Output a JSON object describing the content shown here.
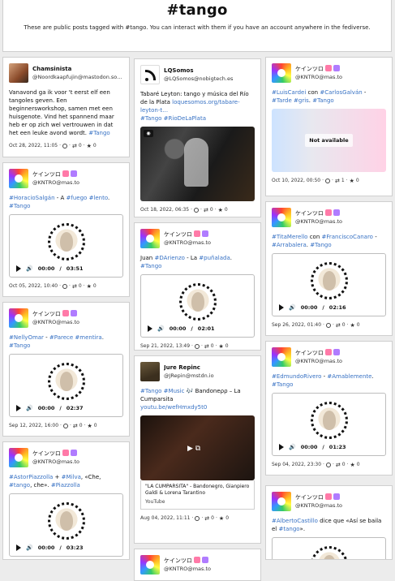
{
  "header": {
    "title": "#tango",
    "subtitle": "These are public posts tagged with #tango. You can interact with them if you have an account anywhere in the fediverse."
  },
  "cards": {
    "c1": {
      "name": "Chamsinista",
      "handle": "@Noordkaapfujin@mastodon.soc…",
      "text": "Vanavond ga ik voor 't eerst elf een tangoles geven. Een beginnersworkshop, samen met een huisgenote. Vind het spannend maar heb er op zich wel vertrouwen in dat het een leuke avond wordt. ",
      "tag1": "#Tango",
      "date": "Oct 28, 2022, 11:05",
      "boosts": "0",
      "favs": "0"
    },
    "c2": {
      "name": "ケインツロ",
      "handle": "@KNTRO@mas.to",
      "t1": "#HoracioSalgán",
      "t2": " - A ",
      "t3": "#fuego",
      "t4": " ",
      "t5": "#lento",
      "t6": ".",
      "t7": "#Tango",
      "time": "00:00",
      "sep": "/",
      "duration": "03:51",
      "date": "Oct 05, 2022, 10:40",
      "boosts": "0",
      "favs": "0"
    },
    "c3": {
      "name": "ケインツロ",
      "handle": "@KNTRO@mas.to",
      "t1": "#NellyOmar",
      "t2": " - ",
      "t3": "#Parece",
      "t4": " ",
      "t5": "#mentira",
      "t6": ". ",
      "t7": "#Tango",
      "time": "00:00",
      "sep": "/",
      "duration": "02:37",
      "date": "Sep 12, 2022, 16:00",
      "boosts": "0",
      "favs": "0"
    },
    "c4": {
      "name": "ケインツロ",
      "handle": "@KNTRO@mas.to",
      "t1": "#AstorPiazzolla",
      "t2": " + ",
      "t3": "#Milva",
      "t4": ", «Che, ",
      "t5": "#tango",
      "t6": ", che». ",
      "t7": "#Piazzolla",
      "time": "00:00",
      "sep": "/",
      "duration": "03:23"
    },
    "c5": {
      "name": "LQSomos",
      "handle": "@LQSomos@nobigtech.es",
      "text": "Tabaré Leyton: tango y música del Río de la Plata ",
      "link": "loquesomos.org/tabare-leyton-t…",
      "tag1": "#Tango",
      "tag2": "#RioDeLaPlata",
      "date": "Oct 18, 2022, 06:35",
      "boosts": "0",
      "favs": "0"
    },
    "c6": {
      "name": "ケインツロ",
      "handle": "@KNTRO@mas.to",
      "t1": "Juan ",
      "t2": "#DArienzo",
      "t3": " - La ",
      "t4": "#puñalada",
      "t5": ". ",
      "t6": "#Tango",
      "time": "00:00",
      "sep": "/",
      "duration": "02:01",
      "date": "Sep 21, 2022, 13:49",
      "boosts": "0",
      "favs": "0"
    },
    "c7": {
      "name": "Jure Repinc",
      "handle": "@JRepin@mstdn.io",
      "t1": "#Tango",
      "t2": " ",
      "t3": "#Music",
      "t4": " 🎶 Bandoneρρ – La Cumparsita",
      "link": "youtu.be/wefHmxdy5t0",
      "yt_title": "\"LA CUMPARSITA\" - Bandonegro, Gianpiero Galdi & Lorena Tarantino",
      "yt_source": "YouTube",
      "date": "Aug 04, 2022, 11:11",
      "boosts": "0",
      "favs": "0"
    },
    "c8": {
      "name": "ケインツロ",
      "handle": "@KNTRO@mas.to"
    },
    "c9": {
      "name": "ケインツロ",
      "handle": "@KNTRO@mas.to",
      "t1": "#LuisCardei",
      "t2": " con ",
      "t3": "#CarlosGalván",
      "t4": " - ",
      "t5": "#Tarde",
      "t6": " ",
      "t7": "#gris",
      "t8": ". ",
      "t9": "#Tango",
      "not_available": "Not available",
      "date": "Oct 10, 2022, 00:50",
      "boosts": "1",
      "favs": "0"
    },
    "c10": {
      "name": "ケインツロ",
      "handle": "@KNTRO@mas.to",
      "t1": "#TitaMerello",
      "t2": " con ",
      "t3": "#FranciscoCanaro",
      "t4": " - ",
      "t5": "#Arrabalera",
      "t6": ". ",
      "t7": "#Tango",
      "time": "00:00",
      "sep": "/",
      "duration": "02:16",
      "date": "Sep 26, 2022, 01:40",
      "boosts": "0",
      "favs": "0"
    },
    "c11": {
      "name": "ケインツロ",
      "handle": "@KNTRO@mas.to",
      "t1": "#EdmundoRivero",
      "t2": " - ",
      "t3": "#Amablemente",
      "t4": ".",
      "t5": "#Tango",
      "time": "00:00",
      "sep": "/",
      "duration": "01:23",
      "date": "Sep 04, 2022, 23:30",
      "boosts": "0",
      "favs": "0"
    },
    "c12": {
      "name": "ケインツロ",
      "handle": "@KNTRO@mas.to",
      "t1": "#AlbertoCastillo",
      "t2": " dice que «Así se baila el ",
      "t3": "#tango",
      "t4": "»."
    }
  }
}
